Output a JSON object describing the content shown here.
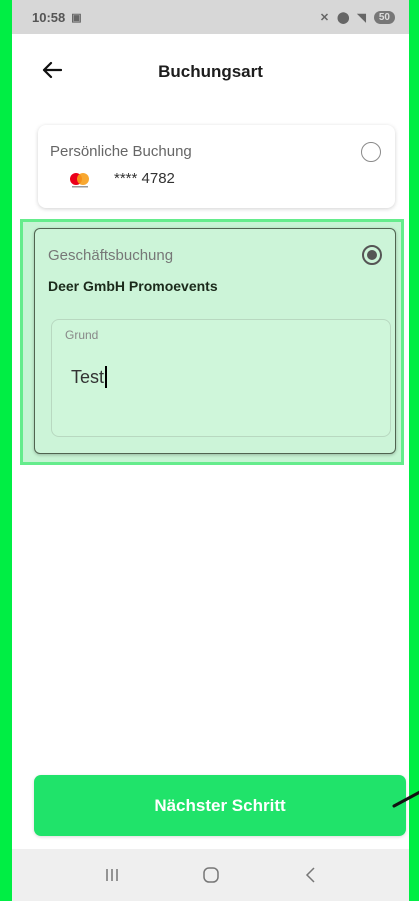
{
  "status_bar": {
    "time": "10:58",
    "battery": "50"
  },
  "header": {
    "title": "Buchungsart"
  },
  "personal_card": {
    "title": "Persönliche Buchung",
    "card_number": "**** 4782",
    "selected": false
  },
  "business_card": {
    "title": "Geschäftsbuchung",
    "company": "Deer GmbH Promoevents",
    "selected": true,
    "reason": {
      "label": "Grund",
      "value": "Test"
    }
  },
  "footer": {
    "next_label": "Nächster Schritt"
  },
  "colors": {
    "accent": "#20e36a",
    "selected_card_bg": "#ccf4d8",
    "highlight": "#65ec8c"
  }
}
